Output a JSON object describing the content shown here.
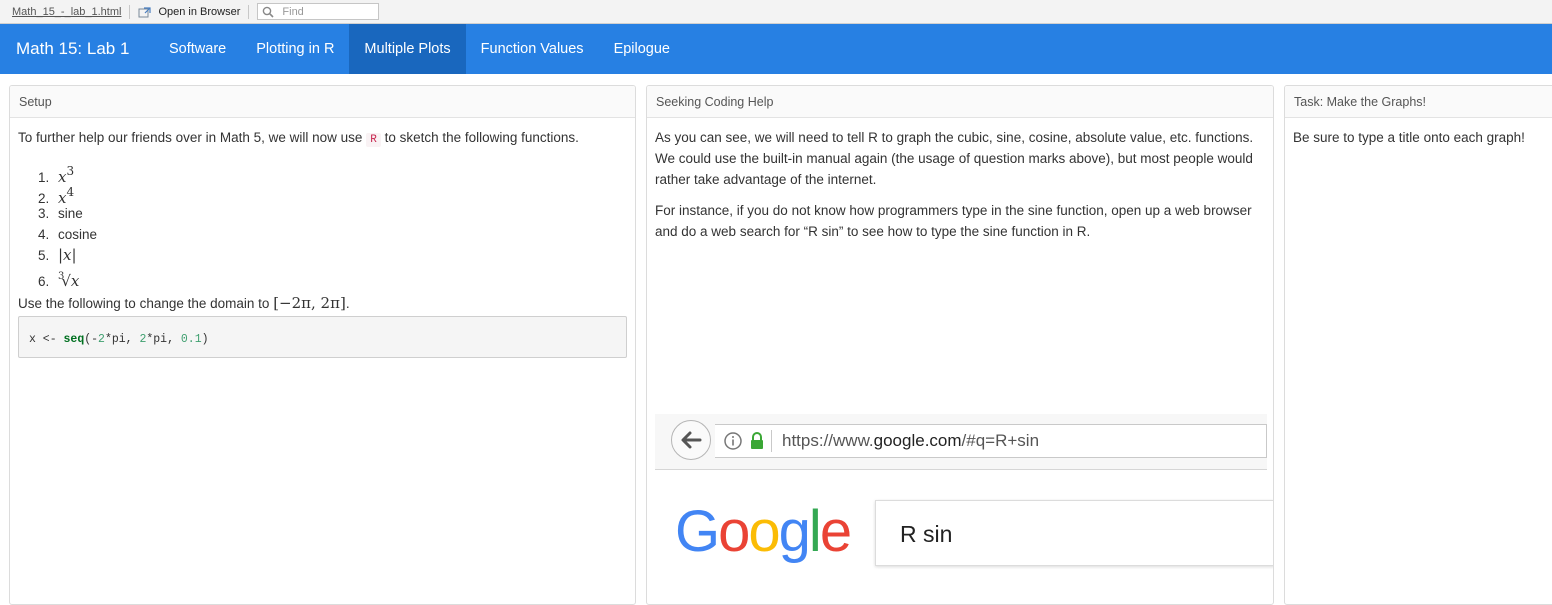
{
  "viewer": {
    "file_name": "Math_15_-_lab_1.html",
    "open_browser_label": "Open in Browser",
    "find_placeholder": "Find"
  },
  "navbar": {
    "brand": "Math 15: Lab 1",
    "items": [
      {
        "label": "Software",
        "active": false
      },
      {
        "label": "Plotting in R",
        "active": false
      },
      {
        "label": "Multiple Plots",
        "active": true
      },
      {
        "label": "Function Values",
        "active": false
      },
      {
        "label": "Epilogue",
        "active": false
      }
    ],
    "accent": "#2780e3",
    "active_bg": "#1967be"
  },
  "setup": {
    "title": "Setup",
    "intro_before": "To further help our friends over in Math 5, we will now use",
    "intro_code": "R",
    "intro_after": "to sketch the following functions.",
    "functions": [
      {
        "num": "1.",
        "base": "x",
        "exp": "3"
      },
      {
        "num": "2.",
        "base": "x",
        "exp": "4"
      },
      {
        "num": "3.",
        "text": "sine"
      },
      {
        "num": "4.",
        "text": "cosine"
      },
      {
        "num": "5.",
        "math": "|x|"
      },
      {
        "num": "6.",
        "root_index": "3",
        "math": "√x"
      }
    ],
    "domain_text": "Use the following to change the domain to",
    "domain_math": "[−2π, 2π]",
    "domain_end": ".",
    "code": {
      "var": "x <- ",
      "fn": "seq",
      "open": "(-",
      "n1": "2",
      "mid1": "*pi, ",
      "n2": "2",
      "mid2": "*pi, ",
      "n3": "0.1",
      "close": ")"
    }
  },
  "coding_help": {
    "title": "Seeking Coding Help",
    "para1": "As you can see, we will need to tell R to graph the cubic, sine, cosine, absolute value, etc. functions. We could use the built-in manual again (the usage of question marks above), but most people would rather take advantage of the internet.",
    "para2": "For instance, if you do not know how programmers type in the sine function, open up a web browser and do a web search for “R sin” to see how to type the sine function in R.",
    "screenshot": {
      "url_prefix": "https://www.",
      "url_domain": "google.com",
      "url_rest": "/#q=R+sin",
      "logo": [
        "G",
        "o",
        "o",
        "g",
        "l",
        "e"
      ],
      "logo_colors": [
        "#4285f4",
        "#ea4335",
        "#fbbc05",
        "#4285f4",
        "#34a853",
        "#ea4335"
      ],
      "search_text": "R sin"
    }
  },
  "task": {
    "title": "Task: Make the Graphs!",
    "text": "Be sure to type a title onto each graph!"
  }
}
